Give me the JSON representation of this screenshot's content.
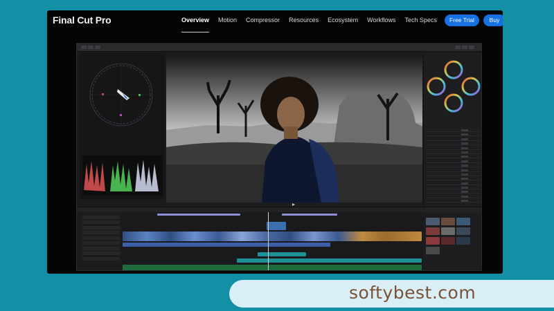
{
  "site": {
    "brand": "Final Cut Pro",
    "nav": [
      {
        "label": "Overview",
        "active": true
      },
      {
        "label": "Motion"
      },
      {
        "label": "Compressor"
      },
      {
        "label": "Resources"
      },
      {
        "label": "Ecosystem"
      },
      {
        "label": "Workflows"
      },
      {
        "label": "Tech Specs"
      }
    ],
    "cta_trial": "Free Trial",
    "cta_buy": "Buy",
    "accent": "#1671e3"
  },
  "watermark": {
    "text": "softybest.com",
    "color": "#7a5236",
    "pill_color": "#d9eef5",
    "background": "#138fa6"
  },
  "app": {
    "scope_label": "",
    "inspector_title": "",
    "viewer_subject": "portrait-in-desert",
    "icons": [
      "vectorscope-icon",
      "waveform-icon",
      "color-wheel-icon"
    ]
  }
}
